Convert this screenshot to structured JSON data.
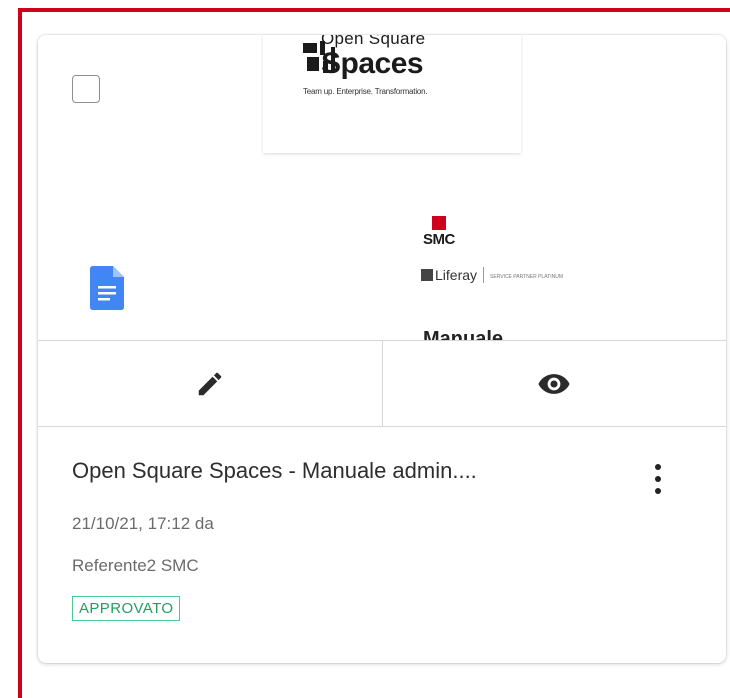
{
  "preview": {
    "logo_line1": "Open Square",
    "logo_line2": "Spaces",
    "logo_tagline": "Team up. Enterprise. Transformation.",
    "smc_logo": "SMC",
    "liferay_logo": "Liferay",
    "liferay_small": "SERVICE PARTNER PLATINUM",
    "doc_heading_peek": "Manuale",
    "file_type_icon": "google-docs-icon",
    "selected": false
  },
  "actions": {
    "edit_icon": "pencil-icon",
    "view_icon": "eye-icon"
  },
  "document": {
    "title": "Open Square Spaces - Manuale admin....",
    "date_line": "21/10/21, 17:12 da",
    "author": "Referente2 SMC",
    "status": "APPROVATO"
  },
  "colors": {
    "frame_border": "#d0021b",
    "status_border": "#4bc98e",
    "status_text": "#1f9f62",
    "doc_icon": "#4285f4"
  }
}
